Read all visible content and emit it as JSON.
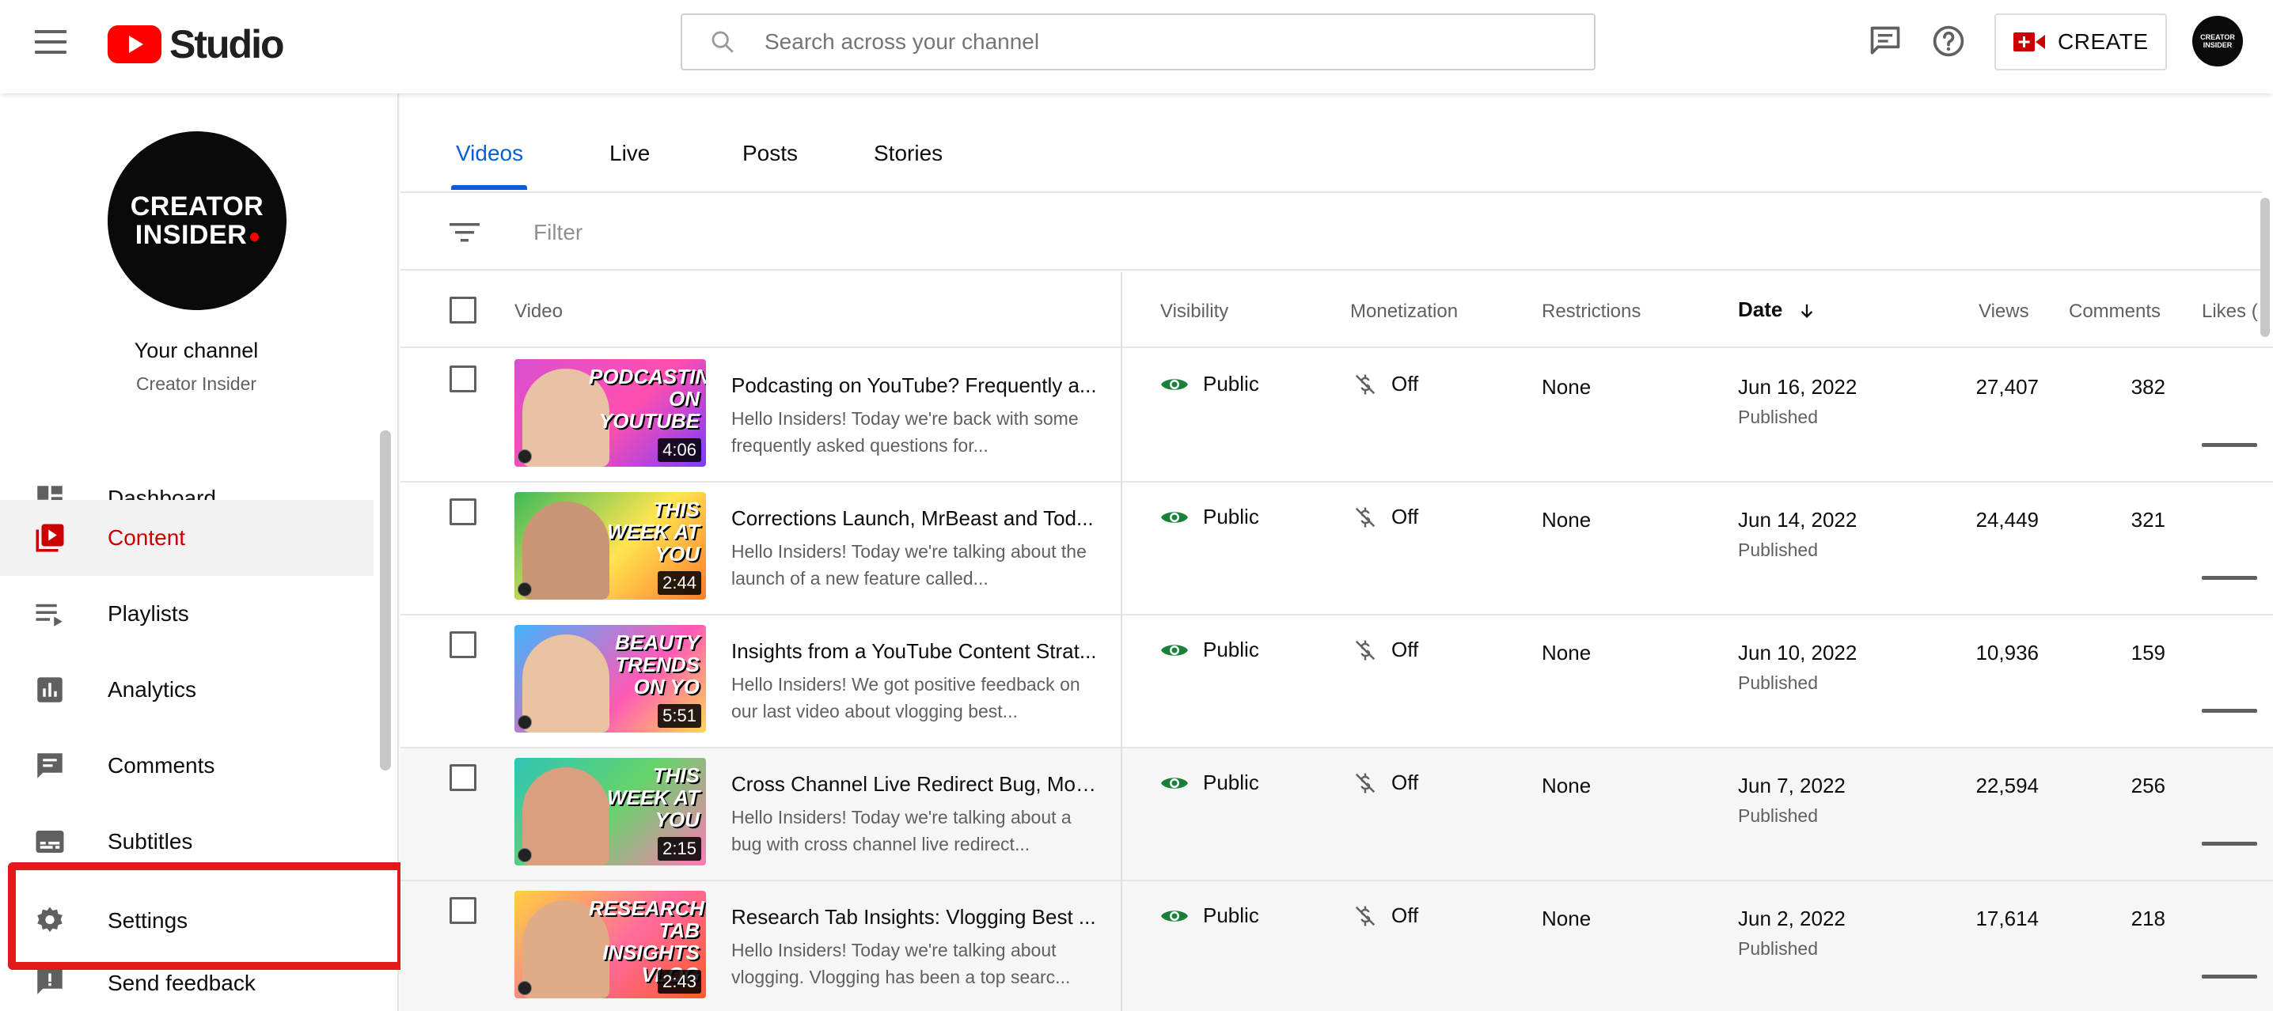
{
  "header": {
    "logo_text": "Studio",
    "search_placeholder": "Search across your channel",
    "create_label": "CREATE",
    "avatar_text": "CREATOR INSIDER"
  },
  "sidebar": {
    "channel_avatar_line1": "CREATOR",
    "channel_avatar_line2": "INSIDER",
    "channel_title": "Your channel",
    "channel_name": "Creator Insider",
    "items": [
      {
        "label": "Dashboard",
        "icon": "dashboard-icon"
      },
      {
        "label": "Content",
        "icon": "content-icon",
        "active": true
      },
      {
        "label": "Playlists",
        "icon": "playlists-icon"
      },
      {
        "label": "Analytics",
        "icon": "analytics-icon"
      },
      {
        "label": "Comments",
        "icon": "comments-icon"
      },
      {
        "label": "Subtitles",
        "icon": "subtitles-icon"
      },
      {
        "label": "Settings",
        "icon": "gear-icon",
        "highlighted": true
      },
      {
        "label": "Send feedback",
        "icon": "feedback-icon"
      }
    ]
  },
  "tabs": [
    {
      "label": "Videos",
      "active": true
    },
    {
      "label": "Live"
    },
    {
      "label": "Posts"
    },
    {
      "label": "Stories"
    }
  ],
  "filter": {
    "placeholder": "Filter"
  },
  "table": {
    "columns": {
      "video": "Video",
      "visibility": "Visibility",
      "monetization": "Monetization",
      "restrictions": "Restrictions",
      "date": "Date",
      "views": "Views",
      "comments": "Comments",
      "likes": "Likes ("
    },
    "rows": [
      {
        "thumb_text": "PODCASTING ON YOUTUBE",
        "duration": "4:06",
        "title": "Podcasting on YouTube? Frequently a...",
        "description": "Hello Insiders! Today we're back with some frequently asked questions for...",
        "visibility": "Public",
        "monetization": "Off",
        "restrictions": "None",
        "date": "Jun 16, 2022",
        "date_status": "Published",
        "views": "27,407",
        "comments": "382"
      },
      {
        "thumb_text": "THIS WEEK AT YOU",
        "duration": "2:44",
        "title": "Corrections Launch, MrBeast and Tod...",
        "description": "Hello Insiders! Today we're talking about the launch of a new feature called...",
        "visibility": "Public",
        "monetization": "Off",
        "restrictions": "None",
        "date": "Jun 14, 2022",
        "date_status": "Published",
        "views": "24,449",
        "comments": "321"
      },
      {
        "thumb_text": "BEAUTY TRENDS ON YO",
        "duration": "5:51",
        "title": "Insights from a YouTube Content Strat...",
        "description": "Hello Insiders! We got positive feedback on our last video about vlogging best...",
        "visibility": "Public",
        "monetization": "Off",
        "restrictions": "None",
        "date": "Jun 10, 2022",
        "date_status": "Published",
        "views": "10,936",
        "comments": "159"
      },
      {
        "thumb_text": "THIS WEEK AT YOU",
        "duration": "2:15",
        "title": "Cross Channel Live Redirect Bug, Mob...",
        "description": "Hello Insiders! Today we're talking about a bug with cross channel live redirect...",
        "visibility": "Public",
        "monetization": "Off",
        "restrictions": "None",
        "date": "Jun 7, 2022",
        "date_status": "Published",
        "views": "22,594",
        "comments": "256"
      },
      {
        "thumb_text": "RESEARCH TAB INSIGHTS VLOG",
        "duration": "2:43",
        "title": "Research Tab Insights: Vlogging Best ...",
        "description": "Hello Insiders! Today we're talking about vlogging. Vlogging has been a top searc...",
        "visibility": "Public",
        "monetization": "Off",
        "restrictions": "None",
        "date": "Jun 2, 2022",
        "date_status": "Published",
        "views": "17,614",
        "comments": "218"
      }
    ]
  },
  "colors": {
    "brand_red": "#ff0000",
    "active_red": "#cc0000",
    "tab_blue": "#065fd4",
    "public_green": "#188038",
    "highlight_red": "#e3181a"
  }
}
